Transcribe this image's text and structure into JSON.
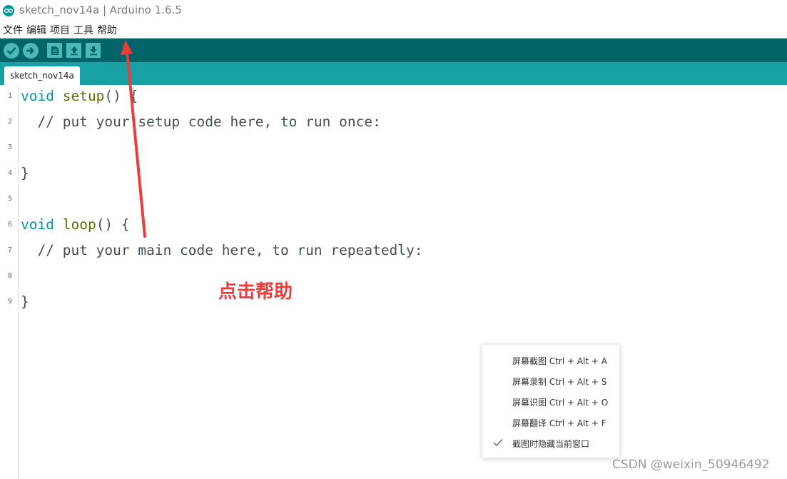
{
  "window": {
    "title": "sketch_nov14a | Arduino 1.6.5"
  },
  "menubar": {
    "items": [
      "文件",
      "编辑",
      "项目",
      "工具",
      "帮助"
    ]
  },
  "toolbar": {
    "buttons": [
      "verify-icon",
      "upload-icon",
      "new-icon",
      "open-icon",
      "save-icon"
    ]
  },
  "tabs": [
    {
      "label": "sketch_nov14a"
    }
  ],
  "editor": {
    "lines": [
      {
        "no": "1",
        "text": "void setup() {"
      },
      {
        "no": "2",
        "text": "  // put your setup code here, to run once:"
      },
      {
        "no": "3",
        "text": ""
      },
      {
        "no": "4",
        "text": "}"
      },
      {
        "no": "5",
        "text": ""
      },
      {
        "no": "6",
        "text": "void loop() {"
      },
      {
        "no": "7",
        "text": "  // put your main code here, to run repeatedly:"
      },
      {
        "no": "8",
        "text": ""
      },
      {
        "no": "9",
        "text": "}"
      }
    ]
  },
  "annotation": {
    "text": "点击帮助",
    "color": "#ee3b3b"
  },
  "context_menu": {
    "items": [
      {
        "label": "屏幕截图 Ctrl + Alt + A",
        "checked": false
      },
      {
        "label": "屏幕录制 Ctrl + Alt + S",
        "checked": false
      },
      {
        "label": "屏幕识图 Ctrl + Alt + O",
        "checked": false
      },
      {
        "label": "屏幕翻译 Ctrl + Alt + F",
        "checked": false
      },
      {
        "label": "截图时隐藏当前窗口",
        "checked": true
      }
    ]
  },
  "watermark": "CSDN @weixin_50946492",
  "colors": {
    "toolbar_bg": "#006468",
    "tabstrip_bg": "#17a1a5",
    "button_bg": "#4db7bb"
  }
}
